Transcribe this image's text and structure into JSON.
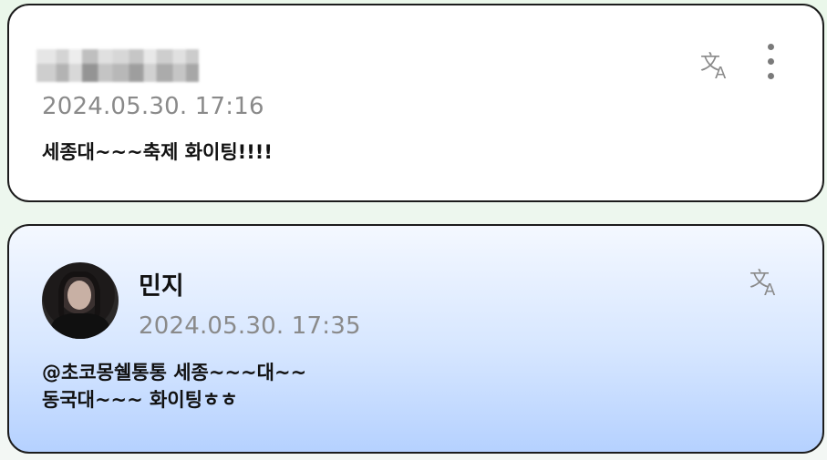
{
  "comments": [
    {
      "author_name": "",
      "author_blurred": true,
      "timestamp": "2024.05.30. 17:16",
      "text": "세종대~~~축제 화이팅!!!!",
      "actions": [
        "translate-icon",
        "more-vertical-icon"
      ]
    },
    {
      "author_name": "민지",
      "timestamp": "2024.05.30. 17:35",
      "text": "@초코몽쉘통통 세종~~~대~~\n동국대~~~ 화이팅ㅎㅎ",
      "actions": [
        "translate-icon"
      ]
    }
  ]
}
